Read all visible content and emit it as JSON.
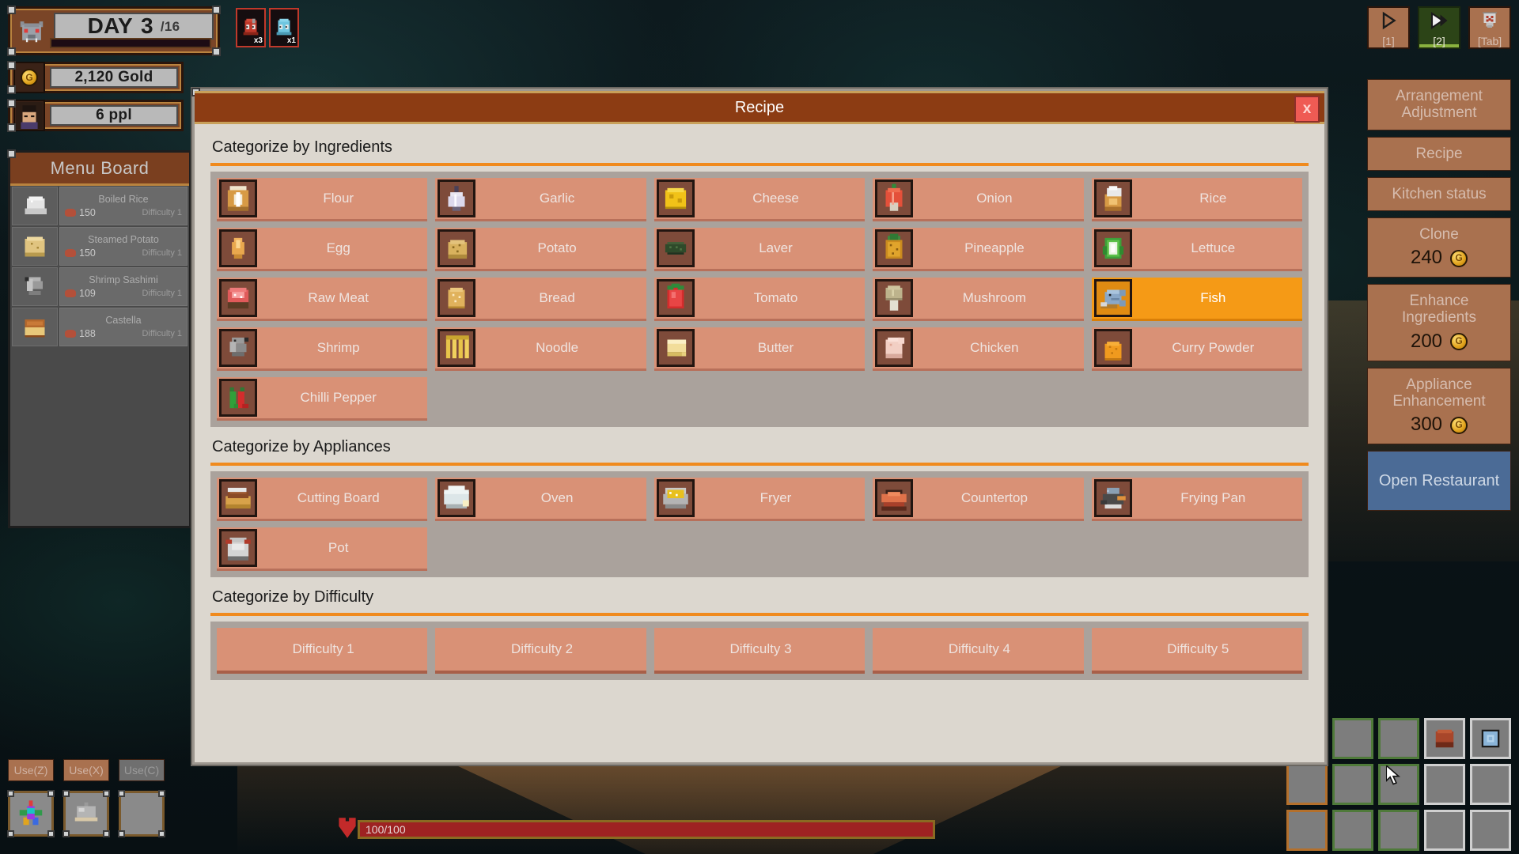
{
  "hud": {
    "day_label": "DAY",
    "day_number": "3",
    "day_max": "/16",
    "gold": "2,120 Gold",
    "population": "6 ppl",
    "enemies": [
      {
        "name": "red-slime",
        "count": "x3",
        "color": "#c0392b"
      },
      {
        "name": "blue-slime",
        "count": "x1",
        "color": "#6fc6e0"
      }
    ]
  },
  "menu_board": {
    "title": "Menu Board",
    "items": [
      {
        "name": "Boiled Rice",
        "price": "150",
        "difficulty": "Difficulty 1",
        "icon": "boiled-rice-icon"
      },
      {
        "name": "Steamed Potato",
        "price": "150",
        "difficulty": "Difficulty 1",
        "icon": "steamed-potato-icon"
      },
      {
        "name": "Shrimp Sashimi",
        "price": "109",
        "difficulty": "Difficulty 1",
        "icon": "shrimp-sashimi-icon"
      },
      {
        "name": "Castella",
        "price": "188",
        "difficulty": "Difficulty 1",
        "icon": "castella-icon"
      }
    ]
  },
  "hotkeys": [
    {
      "label": "[1]",
      "icon": "play-outline-icon",
      "active": false
    },
    {
      "label": "[2]",
      "icon": "play-fast-icon",
      "active": true
    },
    {
      "label": "[Tab]",
      "icon": "shield-icon",
      "active": false
    }
  ],
  "sidebar": {
    "buttons": [
      {
        "label": "Arrangement Adjustment",
        "cost": null,
        "style": "normal"
      },
      {
        "label": "Recipe",
        "cost": null,
        "style": "normal"
      },
      {
        "label": "Kitchen status",
        "cost": null,
        "style": "normal"
      },
      {
        "label": "Clone",
        "cost": "240",
        "style": "normal"
      },
      {
        "label": "Enhance Ingredients",
        "cost": "200",
        "style": "normal"
      },
      {
        "label": "Appliance Enhancement",
        "cost": "300",
        "style": "normal"
      },
      {
        "label": "Open Restaurant",
        "cost": null,
        "style": "primary"
      }
    ]
  },
  "dialog": {
    "title": "Recipe",
    "close_label": "x",
    "sections": [
      {
        "title": "Categorize by Ingredients",
        "items": [
          {
            "label": "Flour",
            "icon": "flour-sack-icon",
            "selected": false
          },
          {
            "label": "Garlic",
            "icon": "garlic-icon",
            "selected": false
          },
          {
            "label": "Cheese",
            "icon": "cheese-icon",
            "selected": false
          },
          {
            "label": "Onion",
            "icon": "onion-icon",
            "selected": false
          },
          {
            "label": "Rice",
            "icon": "rice-icon",
            "selected": false
          },
          {
            "label": "Egg",
            "icon": "egg-icon",
            "selected": false
          },
          {
            "label": "Potato",
            "icon": "potato-icon",
            "selected": false
          },
          {
            "label": "Laver",
            "icon": "laver-icon",
            "selected": false
          },
          {
            "label": "Pineapple",
            "icon": "pineapple-icon",
            "selected": false
          },
          {
            "label": "Lettuce",
            "icon": "lettuce-icon",
            "selected": false
          },
          {
            "label": "Raw Meat",
            "icon": "raw-meat-icon",
            "selected": false
          },
          {
            "label": "Bread",
            "icon": "bread-icon",
            "selected": false
          },
          {
            "label": "Tomato",
            "icon": "tomato-icon",
            "selected": false
          },
          {
            "label": "Mushroom",
            "icon": "mushroom-icon",
            "selected": false
          },
          {
            "label": "Fish",
            "icon": "fish-icon",
            "selected": true
          },
          {
            "label": "Shrimp",
            "icon": "shrimp-icon",
            "selected": false
          },
          {
            "label": "Noodle",
            "icon": "noodle-icon",
            "selected": false
          },
          {
            "label": "Butter",
            "icon": "butter-icon",
            "selected": false
          },
          {
            "label": "Chicken",
            "icon": "chicken-icon",
            "selected": false
          },
          {
            "label": "Curry Powder",
            "icon": "curry-powder-icon",
            "selected": false
          },
          {
            "label": "Chilli Pepper",
            "icon": "chilli-pepper-icon",
            "selected": false
          }
        ]
      },
      {
        "title": "Categorize by Appliances",
        "items": [
          {
            "label": "Cutting Board",
            "icon": "cutting-board-icon",
            "selected": false
          },
          {
            "label": "Oven",
            "icon": "oven-icon",
            "selected": false
          },
          {
            "label": "Fryer",
            "icon": "fryer-icon",
            "selected": false
          },
          {
            "label": "Countertop",
            "icon": "countertop-icon",
            "selected": false
          },
          {
            "label": "Frying Pan",
            "icon": "frying-pan-icon",
            "selected": false
          },
          {
            "label": "Pot",
            "icon": "pot-icon",
            "selected": false
          }
        ]
      },
      {
        "title": "Categorize by Difficulty",
        "items": [
          {
            "label": "Difficulty 1",
            "icon": null,
            "selected": false
          },
          {
            "label": "Difficulty 2",
            "icon": null,
            "selected": false
          },
          {
            "label": "Difficulty 3",
            "icon": null,
            "selected": false
          },
          {
            "label": "Difficulty 4",
            "icon": null,
            "selected": false
          },
          {
            "label": "Difficulty 5",
            "icon": null,
            "selected": false
          }
        ]
      }
    ]
  },
  "bottom": {
    "use_buttons": [
      {
        "label": "Use(Z)",
        "enabled": true
      },
      {
        "label": "Use(X)",
        "enabled": true
      },
      {
        "label": "Use(C)",
        "enabled": false
      }
    ],
    "slots": [
      {
        "icon": "rainbow-star-icon"
      },
      {
        "icon": "cloche-icon"
      },
      {
        "icon": null
      }
    ],
    "health": {
      "text": "100/100",
      "percent": 100
    }
  },
  "inventory": {
    "cells": [
      {
        "icon": null,
        "frame": "wood"
      },
      {
        "icon": null,
        "frame": "green"
      },
      {
        "icon": null,
        "frame": "green"
      },
      {
        "icon": "red-block-icon",
        "frame": "grey"
      },
      {
        "icon": "blue-plate-icon",
        "frame": "grey"
      },
      {
        "icon": null,
        "frame": "wood"
      },
      {
        "icon": null,
        "frame": "green"
      },
      {
        "icon": null,
        "frame": "green"
      },
      {
        "icon": null,
        "frame": "grey"
      },
      {
        "icon": null,
        "frame": "grey"
      },
      {
        "icon": null,
        "frame": "wood"
      },
      {
        "icon": null,
        "frame": "green"
      },
      {
        "icon": null,
        "frame": "green"
      },
      {
        "icon": null,
        "frame": "grey"
      },
      {
        "icon": null,
        "frame": "grey"
      }
    ]
  },
  "colors": {
    "accent_orange": "#f08a1d",
    "selected": "#f59a16",
    "panel": "#dcd7cf",
    "titlebar": "#8c3c13",
    "item": "#d99176",
    "primary_button": "#4b6b96"
  }
}
